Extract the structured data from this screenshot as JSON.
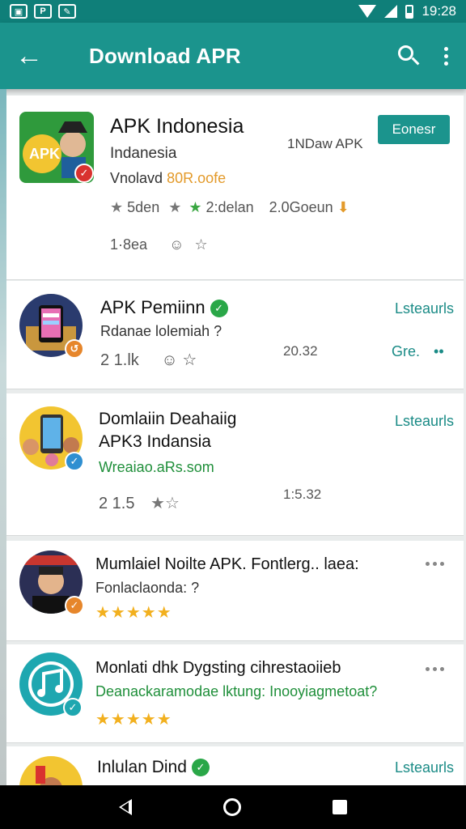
{
  "status": {
    "time": "19:28"
  },
  "app_bar": {
    "title": "Download APR"
  },
  "apps": [
    {
      "name": "APK Indonesia",
      "subtitle": "Indanesia",
      "vendor_prefix": "Vnolavd",
      "vendor_highlight": "80R.oofe",
      "developer": "1NDaw APK",
      "action": "Eonesr",
      "rating_1": "5den",
      "rating_2": "2:delan",
      "rating_3": "2.0Goeun",
      "reviews": "1·8ea"
    },
    {
      "name": "APK Pemiinn",
      "subtitle": "Rdanae lolemiah ?",
      "count": "2 1.lk",
      "date": "20.32",
      "link_top": "Lsteaurls",
      "link_bottom": "Gre."
    },
    {
      "name_line1": "Domlaiin Deahaiig",
      "name_line2": "APK3 Indansia",
      "url": "Wreaiao.aRs.som",
      "count": "2 1.5",
      "date": "1:5.32",
      "link_top": "Lsteaurls"
    },
    {
      "name": "Mumlaiel Noilte APK. Fontlerg.. laea:",
      "subtitle": "Fonlaclaonda: ?",
      "rating_stars": "★★★★★"
    },
    {
      "name": "Monlati dhk Dygsting cihrestaoiieb",
      "subtitle": "Deanackaramodae lktung: Inooyiagmetoat?",
      "rating_stars": "★★★★★"
    },
    {
      "name": "Inlulan Dind",
      "link_top": "Lsteaurls"
    }
  ],
  "colors": {
    "primary": "#1b948d",
    "status": "#0f7f79",
    "accent_link": "#1a8b86",
    "star": "#f2b01e"
  }
}
